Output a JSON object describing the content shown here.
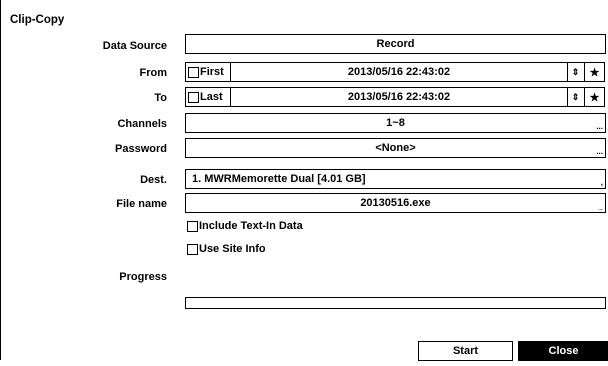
{
  "title": "Clip-Copy",
  "data_source": {
    "label": "Data Source",
    "value": "Record"
  },
  "from": {
    "label": "From",
    "checkbox_label": "First",
    "value": "2013/05/16  22:43:02",
    "spin_icon": "spinner-icon",
    "star_icon": "star-icon"
  },
  "to": {
    "label": "To",
    "checkbox_label": "Last",
    "value": "2013/05/16  22:43:02"
  },
  "channels": {
    "label": "Channels",
    "value": "1~8",
    "more": "..."
  },
  "password": {
    "label": "Password",
    "value": "<None>",
    "more": "..."
  },
  "dest": {
    "label": "Dest.",
    "value": "1. MWRMemorette Dual [4.01 GB]",
    "more": ","
  },
  "file_name": {
    "label": "File name",
    "value": "20130516.exe",
    "more": "_"
  },
  "options": {
    "include_text_in": "Include Text-In Data",
    "use_site_info": "Use Site Info"
  },
  "progress": {
    "label": "Progress",
    "value": 0
  },
  "buttons": {
    "start": "Start",
    "close": "Close"
  },
  "glyphs": {
    "spin": "⇕",
    "star": "★"
  }
}
